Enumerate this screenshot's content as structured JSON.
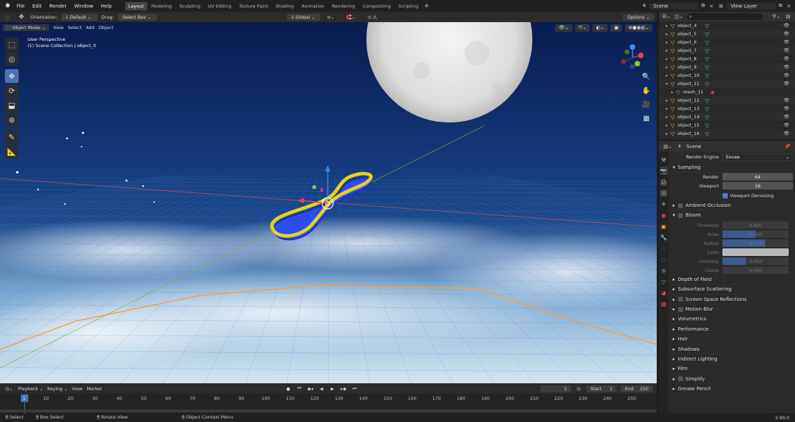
{
  "topbar": {
    "menus": [
      "File",
      "Edit",
      "Render",
      "Window",
      "Help"
    ],
    "workspaces": [
      "Layout",
      "Modeling",
      "Sculpting",
      "UV Editing",
      "Texture Paint",
      "Shading",
      "Animation",
      "Rendering",
      "Compositing",
      "Scripting"
    ],
    "active_workspace": "Layout",
    "scene": "Scene",
    "view_layer": "View Layer"
  },
  "header": {
    "orientation_label": "Orientation:",
    "orientation_value": "Default",
    "drag_label": "Drag:",
    "drag_value": "Select Box",
    "transform_orientation": "Global",
    "options": "Options"
  },
  "viewport": {
    "mode": "Object Mode",
    "menus": [
      "View",
      "Select",
      "Add",
      "Object"
    ],
    "info_line1": "User Perspective",
    "info_line2": "(1) Scene Collection | object_0",
    "gizmo_colors": {
      "x": "#e9414f",
      "y": "#8ac926",
      "z": "#3e8ff0"
    }
  },
  "outliner": {
    "rows": [
      {
        "label": "object_4",
        "type": "object"
      },
      {
        "label": "object_5",
        "type": "object"
      },
      {
        "label": "object_6",
        "type": "object"
      },
      {
        "label": "object_7",
        "type": "object"
      },
      {
        "label": "object_8",
        "type": "object"
      },
      {
        "label": "object_9",
        "type": "object"
      },
      {
        "label": "object_10",
        "type": "object"
      },
      {
        "label": "object_11",
        "type": "object-open"
      },
      {
        "label": "mesh_11",
        "type": "mesh"
      },
      {
        "label": "object_12",
        "type": "object"
      },
      {
        "label": "object_13",
        "type": "object"
      },
      {
        "label": "object_14",
        "type": "object"
      },
      {
        "label": "object_15",
        "type": "object"
      },
      {
        "label": "object_16",
        "type": "object"
      }
    ]
  },
  "properties": {
    "title": "Scene",
    "render_engine_label": "Render Engine",
    "render_engine_value": "Eevee",
    "sampling": "Sampling",
    "render_label": "Render",
    "render_value": "64",
    "viewport_label": "Viewport",
    "viewport_value": "16",
    "denoise_label": "Viewport Denoising",
    "ambient_occlusion": "Ambient Occlusion",
    "bloom": "Bloom",
    "bloom_fields": [
      {
        "label": "Threshold",
        "value": "0.800",
        "fill": 0.0
      },
      {
        "label": "Knee",
        "value": "0.500",
        "fill": 0.5
      },
      {
        "label": "Radius",
        "value": "6.500",
        "fill": 0.65
      },
      {
        "label": "Color",
        "value": "",
        "fill": 1.0
      },
      {
        "label": "Intensity",
        "value": "0.050",
        "fill": 0.35
      },
      {
        "label": "Clamp",
        "value": "0.000",
        "fill": 0.0
      }
    ],
    "sections": [
      {
        "label": "Depth of Field",
        "check": false
      },
      {
        "label": "Subsurface Scattering",
        "check": false
      },
      {
        "label": "Screen Space Reflections",
        "check": true
      },
      {
        "label": "Motion Blur",
        "check": true
      },
      {
        "label": "Volumetrics",
        "check": false
      },
      {
        "label": "Performance",
        "check": false
      },
      {
        "label": "Hair",
        "check": false
      },
      {
        "label": "Shadows",
        "check": false
      },
      {
        "label": "Indirect Lighting",
        "check": false
      },
      {
        "label": "Film",
        "check": false
      },
      {
        "label": "Simplify",
        "check": true
      },
      {
        "label": "Grease Pencil",
        "check": false
      }
    ]
  },
  "timeline": {
    "menus": [
      "Playback",
      "Keying",
      "View",
      "Marker"
    ],
    "current_frame": "1",
    "start_label": "Start",
    "start_value": "1",
    "end_label": "End",
    "end_value": "250",
    "ticks": [
      "1",
      "10",
      "20",
      "30",
      "40",
      "50",
      "60",
      "70",
      "80",
      "90",
      "100",
      "110",
      "120",
      "130",
      "140",
      "150",
      "160",
      "170",
      "180",
      "190",
      "200",
      "210",
      "220",
      "230",
      "240",
      "250"
    ]
  },
  "status": {
    "select": "Select",
    "box_select": "Box Select",
    "rotate_view": "Rotate View",
    "context_menu": "Object Context Menu",
    "version": "2.90.0"
  }
}
